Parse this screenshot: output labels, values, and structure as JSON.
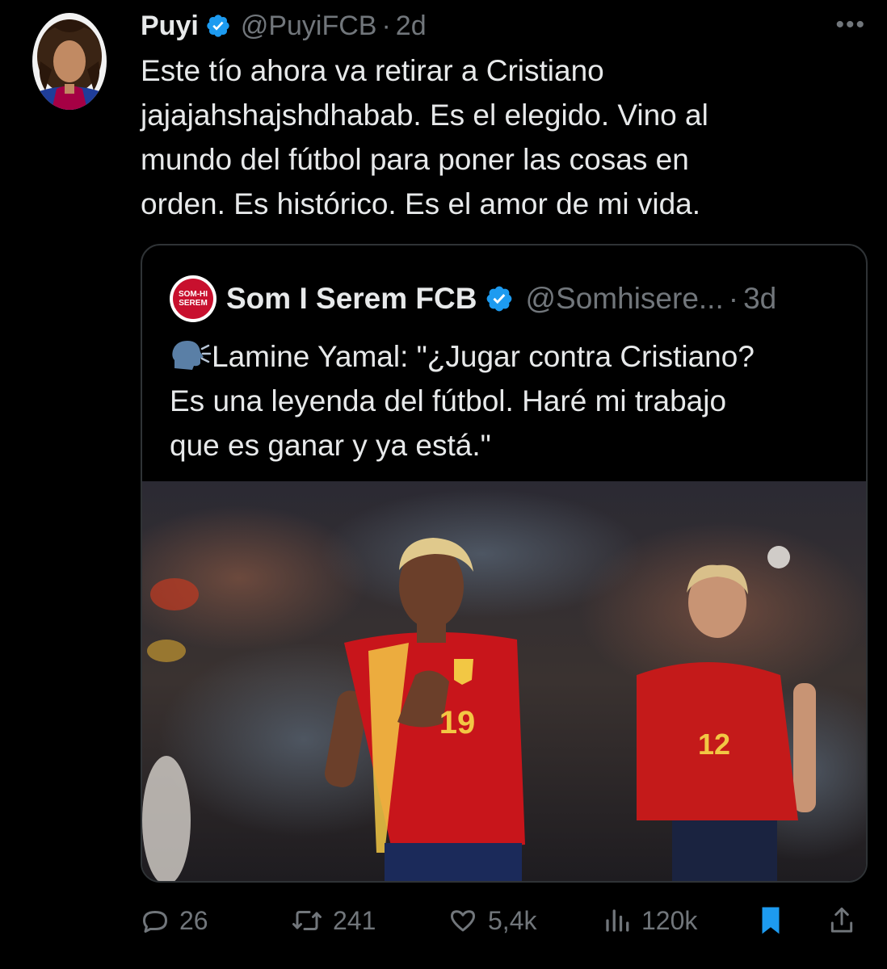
{
  "tweet": {
    "display_name": "Puyi",
    "handle": "@PuyiFCB",
    "separator": "·",
    "time": "2d",
    "more_label": "•••",
    "text_lines": [
      "Este tío ahora va retirar a Cristiano",
      "jajajahshajshdhabab. Es el elegido. Vino al",
      "mundo del fútbol para poner las cosas en",
      "orden. Es histórico. Es el amor de mi vida."
    ]
  },
  "quote": {
    "display_name": "Som I Serem FCB",
    "handle": "@Somhisere...",
    "separator": "·",
    "time": "3d",
    "avatar_text": [
      "SOM-HI",
      "SEREM"
    ],
    "speak_icon": "speaking-head-icon",
    "text_lines": [
      "Lamine Yamal: \"¿Jugar contra Cristiano?",
      "Es una leyenda del fútbol. Haré mi trabajo",
      "que es ganar y ya está.\""
    ],
    "media": {
      "jersey_numbers": [
        "19",
        "12"
      ]
    }
  },
  "actions": {
    "reply_count": "26",
    "repost_count": "241",
    "like_count": "5,4k",
    "views_count": "120k"
  },
  "colors": {
    "background": "#000000",
    "text_primary": "#e7e9ea",
    "text_secondary": "#71767b",
    "verified": "#1d9bf0",
    "bookmark_active": "#1d9bf0",
    "border": "#2f3336"
  }
}
